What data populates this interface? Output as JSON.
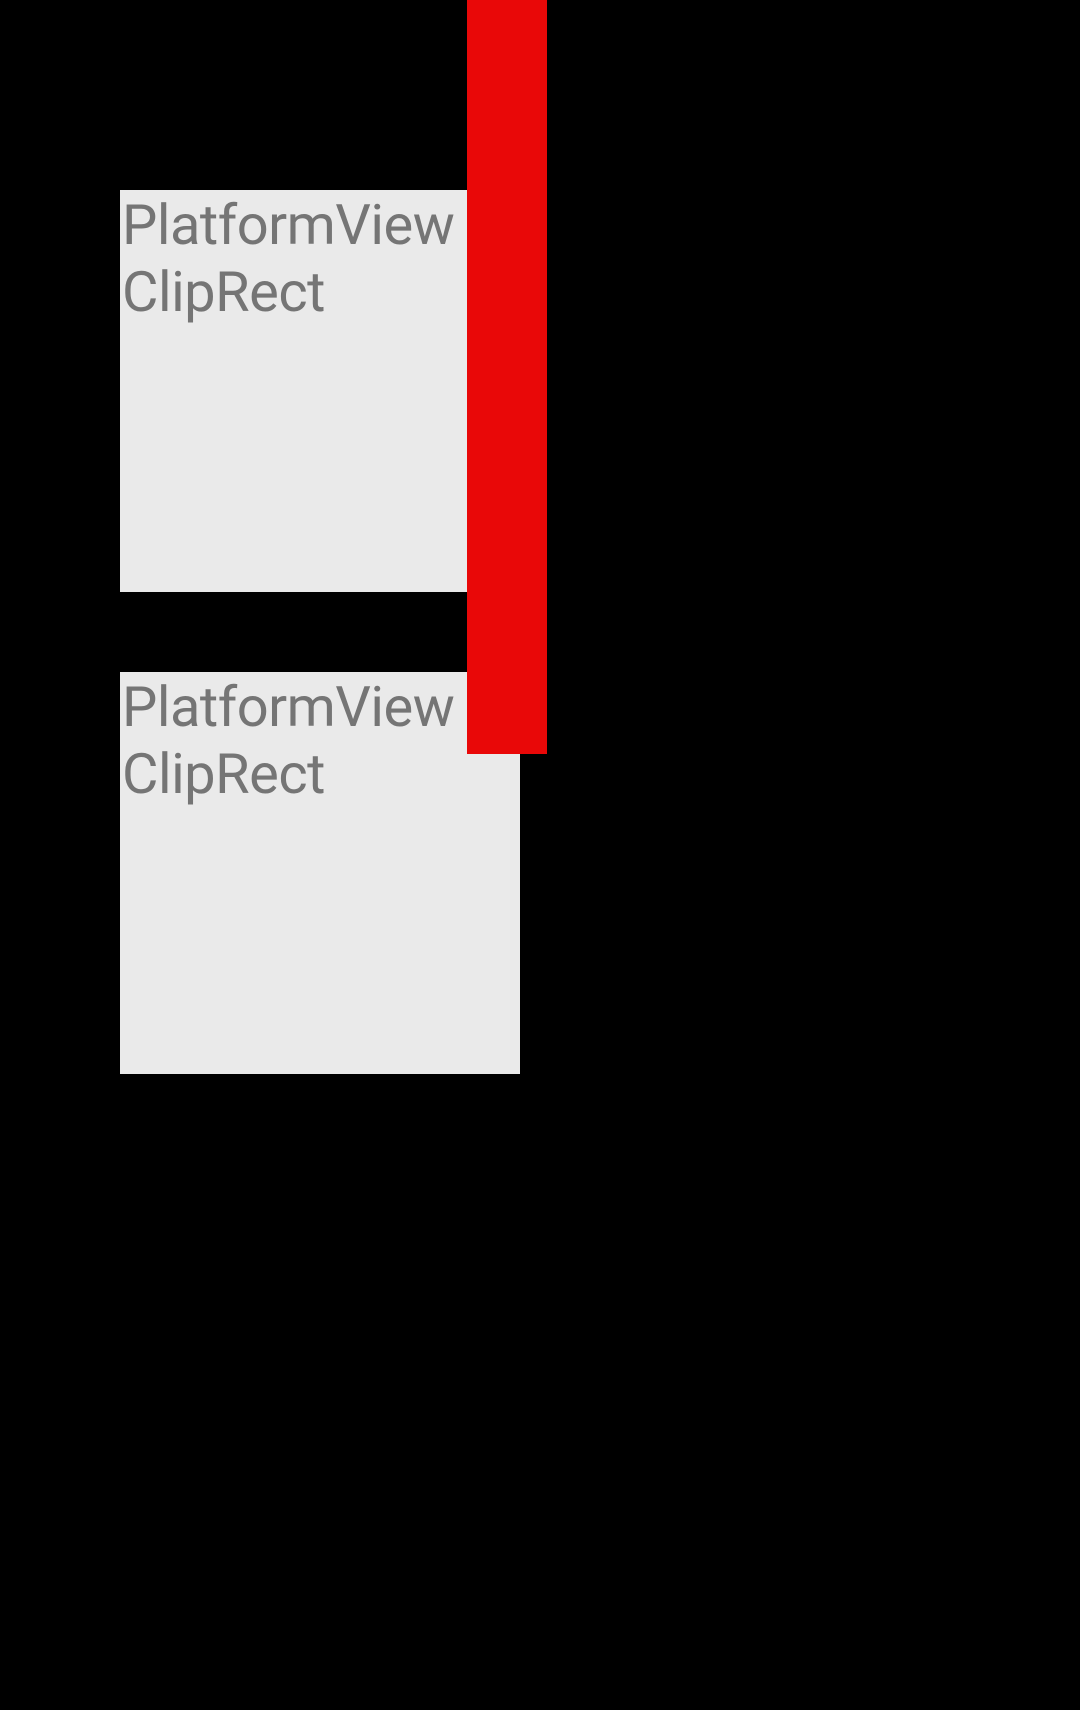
{
  "boxes": [
    {
      "line1": "PlatformView",
      "line2": "ClipRect"
    },
    {
      "line1": "PlatformView",
      "line2": "ClipRect"
    }
  ],
  "colors": {
    "background": "#000000",
    "box_bg": "#EAEAEA",
    "text": "#757575",
    "overlay_bar": "#E90808"
  }
}
